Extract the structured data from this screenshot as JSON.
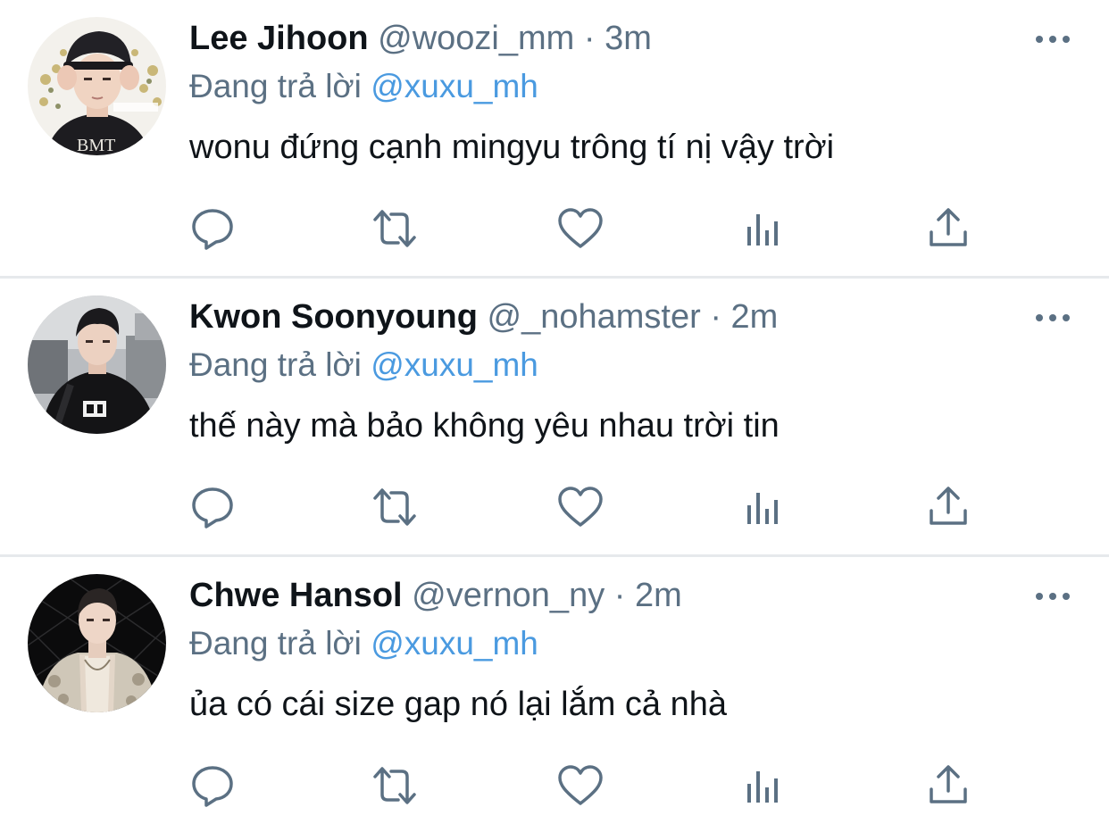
{
  "colors": {
    "text": "#0f1419",
    "secondary": "#5b7083",
    "mention": "#4a9ae0",
    "divider": "#e6e9ec"
  },
  "action_icons": [
    "reply-icon",
    "retweet-icon",
    "like-icon",
    "analytics-icon",
    "share-icon"
  ],
  "tweets": [
    {
      "name": "Lee Jihoon",
      "handle": "@woozi_mm",
      "dot": "·",
      "time": "3m",
      "replying_prefix": "Đang trả lời",
      "replying_to": "@xuxu_mh",
      "text": "wonu đứng cạnh mingyu trông tí nị vậy trời"
    },
    {
      "name": "Kwon Soonyoung",
      "handle": "@_nohamster",
      "dot": "·",
      "time": "2m",
      "replying_prefix": "Đang trả lời",
      "replying_to": "@xuxu_mh",
      "text": "thế này mà bảo không yêu nhau trời tin"
    },
    {
      "name": "Chwe Hansol",
      "handle": "@vernon_ny",
      "dot": "·",
      "time": "2m",
      "replying_prefix": "Đang trả lời",
      "replying_to": "@xuxu_mh",
      "text": "ủa có cái size gap nó lại lắm cả nhà"
    }
  ]
}
